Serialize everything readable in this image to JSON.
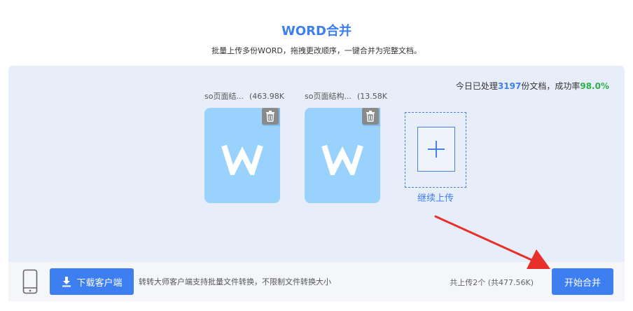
{
  "header": {
    "title": "WORD合并",
    "subtitle": "批量上传多份WORD，拖拽更改顺序，一键合并为完整文档。"
  },
  "stats": {
    "prefix": "今日已处理",
    "count": "3197",
    "middle": "份文档，成功率",
    "rate": "98.0%"
  },
  "files": [
    {
      "name": "so页面结...",
      "size": "(463.98K",
      "icon": "word-doc-icon"
    },
    {
      "name": "so页面结构...",
      "size": "(13.58K",
      "icon": "word-doc-icon"
    }
  ],
  "upload": {
    "label": "继续上传",
    "icon": "plus-icon"
  },
  "footer": {
    "download_label": "下载客户端",
    "client_note": "转转大师客户端支持批量文件转换，不限制文件转换大小",
    "total": "共上传2个 (共477.56K)",
    "merge_label": "开始合并"
  },
  "colors": {
    "accent": "#3d7ef0",
    "success": "#2bb24c",
    "panel": "#e8eef9",
    "doc": "#99d3fd",
    "annotation_arrow": "#e8302a"
  }
}
